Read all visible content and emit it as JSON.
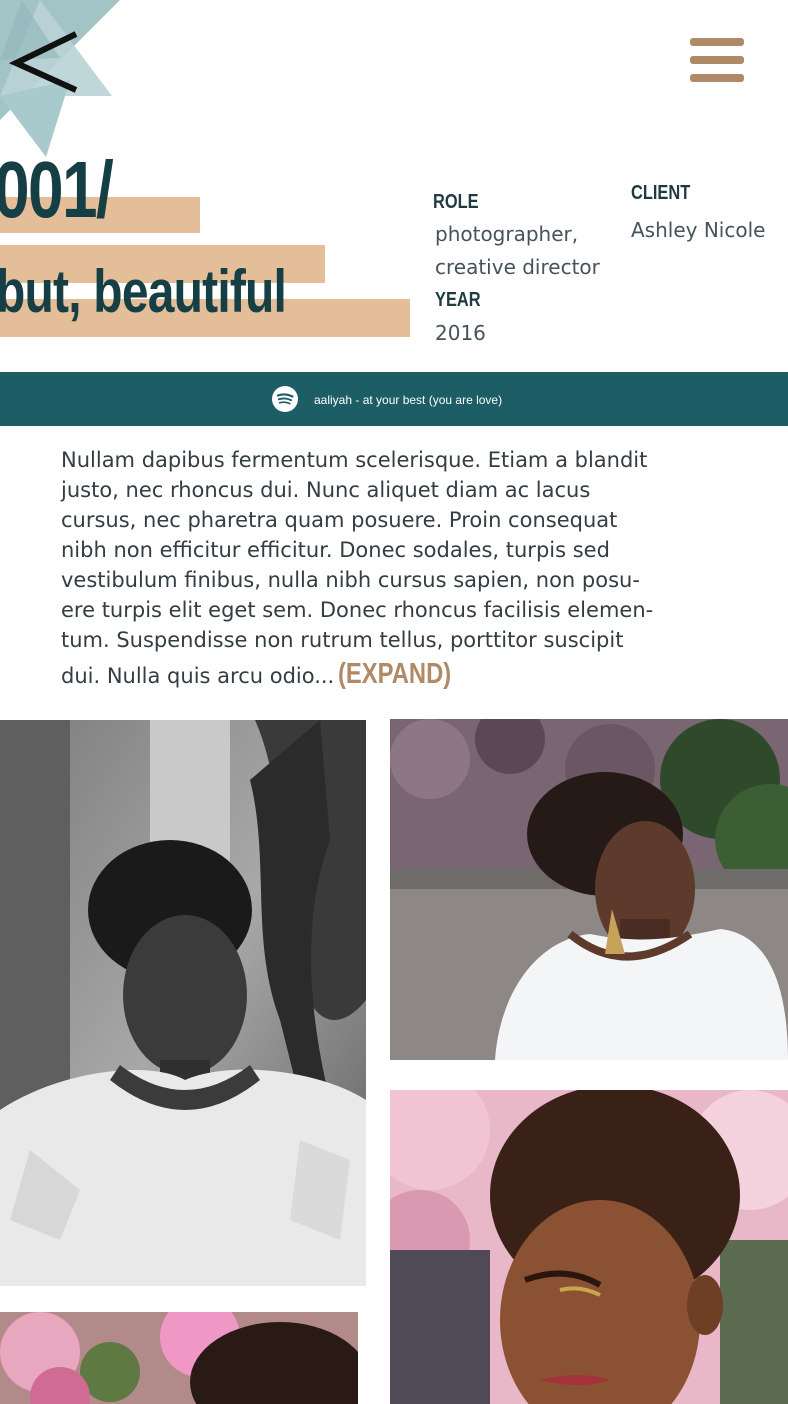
{
  "nav": {
    "back_label": "<",
    "back_icon": "chevron-left-icon",
    "menu_icon": "hamburger-menu-icon",
    "menu_color": "#b08966"
  },
  "project": {
    "number": "001/",
    "title": "but, beautiful",
    "highlight_color": "#e3be98"
  },
  "meta": {
    "role_label": "ROLE",
    "role_lines": [
      "photographer,",
      "creative director"
    ],
    "client_label": "CLIENT",
    "client_value": "Ashley Nicole",
    "year_label": "YEAR",
    "year_value": "2016"
  },
  "now_playing": {
    "icon": "spotify-icon",
    "track": "aaliyah - at your best (you are love)",
    "background": "#1d5d65"
  },
  "description": {
    "lines": [
      "Nullam dapibus fermentum scelerisque. Etiam a blandit",
      "justo, nec rhoncus dui. Nunc aliquet diam ac lacus",
      "cursus, nec pharetra quam posuere. Proin consequat",
      "nibh non efficitur efficitur. Donec sodales, turpis sed",
      "vestibulum finibus, nulla nibh cursus sapien, non posu-",
      "ere turpis elit eget sem. Donec rhoncus facilisis elemen-",
      "tum. Suspendisse non rutrum tellus, porttitor suscipit"
    ],
    "last_line": "dui. Nulla quis arcu odio...",
    "expand_label": "(EXPAND)",
    "accent_color": "#b08966"
  },
  "gallery": [
    {
      "style": "black-and-white portrait beneath a tree"
    },
    {
      "style": "color portrait looking up, leaves behind"
    },
    {
      "style": "color close-up with pink blossoms"
    },
    {
      "style": "color crop with pink blossoms"
    }
  ]
}
